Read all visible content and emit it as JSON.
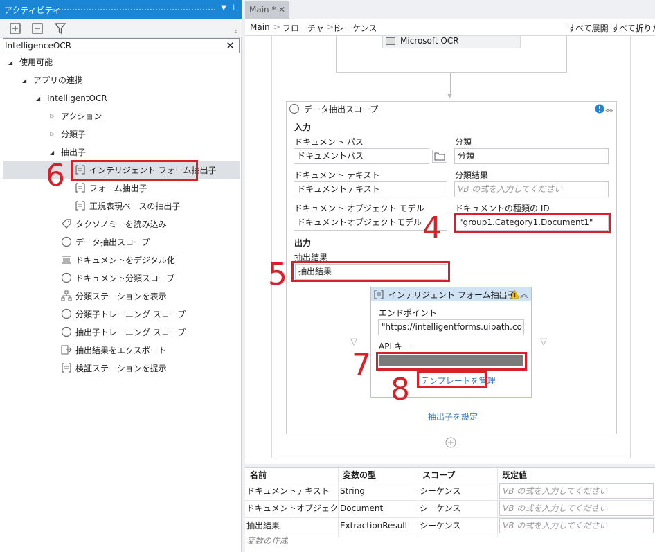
{
  "left_panel": {
    "title": "アクティビティ",
    "search_value": "IntelligenceOCR",
    "tree": {
      "available": "使用可能",
      "app_integration": "アプリの連携",
      "intelligent_ocr": "IntelligentOCR",
      "actions": "アクション",
      "classifiers": "分類子",
      "extractors": "抽出子",
      "intelligent_form_extractor": "インテリジェント フォーム抽出子",
      "form_extractor": "フォーム抽出子",
      "regex_extractor": "正規表現ベースの抽出子",
      "load_taxonomy": "タクソノミーを読み込み",
      "data_extraction_scope": "データ抽出スコープ",
      "digitize_document": "ドキュメントをデジタル化",
      "classify_document_scope": "ドキュメント分類スコープ",
      "present_classification_station": "分類ステーションを表示",
      "train_classifiers_scope": "分類子トレーニング スコープ",
      "train_extractors_scope": "抽出子トレーニング スコープ",
      "export_extraction_results": "抽出結果をエクスポート",
      "present_validation_station": "検証ステーションを提示"
    }
  },
  "annotations": {
    "n4": "4",
    "n5": "5",
    "n6": "6",
    "n7": "7",
    "n8": "8"
  },
  "editor": {
    "tab_label": "Main *",
    "tab_close": "✕",
    "breadcrumb": {
      "main": "Main",
      "flowchart": "フローチャート",
      "sequence": "シーケンス",
      "sep": ">"
    },
    "expand_all": "すべて展開",
    "collapse_all": "すべて折りたたむ",
    "microsoft_ocr": "Microsoft OCR",
    "scope": {
      "title": "データ抽出スコープ",
      "input_header": "入力",
      "document_path_label": "ドキュメント パス",
      "document_path_value": "ドキュメントパス",
      "classification_label": "分類",
      "classification_value": "分類",
      "document_text_label": "ドキュメント テキスト",
      "document_text_value": "ドキュメントテキスト",
      "classification_result_label": "分類結果",
      "classification_result_placeholder": "VB の式を入力してください",
      "document_object_model_label": "ドキュメント オブジェクト モデル",
      "document_object_model_value": "ドキュメントオブジェクトモデル",
      "document_type_id_label": "ドキュメントの種類の ID",
      "document_type_id_value": "\"group1.Category1.Document1\"",
      "output_header": "出力",
      "extraction_result_label": "抽出結果",
      "extraction_result_value": "抽出結果",
      "configure_extractors": "抽出子を設定"
    },
    "extractor": {
      "title": "インテリジェント フォーム抽出子",
      "endpoint_label": "エンドポイント",
      "endpoint_value": "\"https://intelligentforms.uipath.com/\"",
      "api_key_label": "API キー",
      "manage_templates": "テンプレートを管理"
    }
  },
  "variables": {
    "headers": [
      "名前",
      "変数の型",
      "スコープ",
      "既定値"
    ],
    "rows": [
      {
        "name": "ドキュメントテキスト",
        "type": "String",
        "scope": "シーケンス",
        "default": "VB の式を入力してください"
      },
      {
        "name": "ドキュメントオブジェクトモデル",
        "type": "Document",
        "scope": "シーケンス",
        "default": "VB の式を入力してください"
      },
      {
        "name": "抽出結果",
        "type": "ExtractionResult",
        "scope": "シーケンス",
        "default": "VB の式を入力してください"
      }
    ],
    "create_variable": "変数の作成"
  },
  "colors": {
    "accent": "#1c86d6",
    "annotation_red": "#d8202a",
    "link_blue": "#3a7dbf"
  }
}
